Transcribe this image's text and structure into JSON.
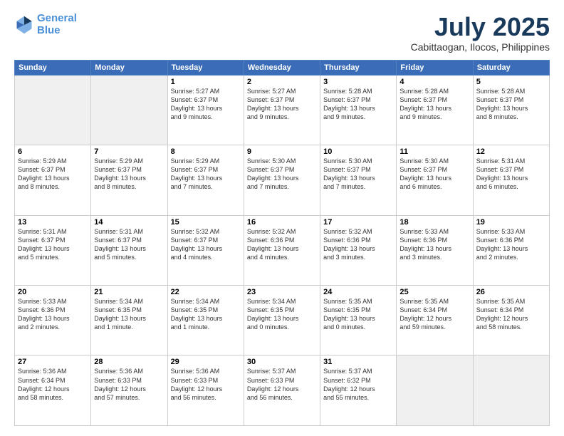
{
  "header": {
    "logo_line1": "General",
    "logo_line2": "Blue",
    "month": "July 2025",
    "location": "Cabittaogan, Ilocos, Philippines"
  },
  "weekdays": [
    "Sunday",
    "Monday",
    "Tuesday",
    "Wednesday",
    "Thursday",
    "Friday",
    "Saturday"
  ],
  "weeks": [
    [
      {
        "day": "",
        "detail": ""
      },
      {
        "day": "",
        "detail": ""
      },
      {
        "day": "1",
        "detail": "Sunrise: 5:27 AM\nSunset: 6:37 PM\nDaylight: 13 hours\nand 9 minutes."
      },
      {
        "day": "2",
        "detail": "Sunrise: 5:27 AM\nSunset: 6:37 PM\nDaylight: 13 hours\nand 9 minutes."
      },
      {
        "day": "3",
        "detail": "Sunrise: 5:28 AM\nSunset: 6:37 PM\nDaylight: 13 hours\nand 9 minutes."
      },
      {
        "day": "4",
        "detail": "Sunrise: 5:28 AM\nSunset: 6:37 PM\nDaylight: 13 hours\nand 9 minutes."
      },
      {
        "day": "5",
        "detail": "Sunrise: 5:28 AM\nSunset: 6:37 PM\nDaylight: 13 hours\nand 8 minutes."
      }
    ],
    [
      {
        "day": "6",
        "detail": "Sunrise: 5:29 AM\nSunset: 6:37 PM\nDaylight: 13 hours\nand 8 minutes."
      },
      {
        "day": "7",
        "detail": "Sunrise: 5:29 AM\nSunset: 6:37 PM\nDaylight: 13 hours\nand 8 minutes."
      },
      {
        "day": "8",
        "detail": "Sunrise: 5:29 AM\nSunset: 6:37 PM\nDaylight: 13 hours\nand 7 minutes."
      },
      {
        "day": "9",
        "detail": "Sunrise: 5:30 AM\nSunset: 6:37 PM\nDaylight: 13 hours\nand 7 minutes."
      },
      {
        "day": "10",
        "detail": "Sunrise: 5:30 AM\nSunset: 6:37 PM\nDaylight: 13 hours\nand 7 minutes."
      },
      {
        "day": "11",
        "detail": "Sunrise: 5:30 AM\nSunset: 6:37 PM\nDaylight: 13 hours\nand 6 minutes."
      },
      {
        "day": "12",
        "detail": "Sunrise: 5:31 AM\nSunset: 6:37 PM\nDaylight: 13 hours\nand 6 minutes."
      }
    ],
    [
      {
        "day": "13",
        "detail": "Sunrise: 5:31 AM\nSunset: 6:37 PM\nDaylight: 13 hours\nand 5 minutes."
      },
      {
        "day": "14",
        "detail": "Sunrise: 5:31 AM\nSunset: 6:37 PM\nDaylight: 13 hours\nand 5 minutes."
      },
      {
        "day": "15",
        "detail": "Sunrise: 5:32 AM\nSunset: 6:37 PM\nDaylight: 13 hours\nand 4 minutes."
      },
      {
        "day": "16",
        "detail": "Sunrise: 5:32 AM\nSunset: 6:36 PM\nDaylight: 13 hours\nand 4 minutes."
      },
      {
        "day": "17",
        "detail": "Sunrise: 5:32 AM\nSunset: 6:36 PM\nDaylight: 13 hours\nand 3 minutes."
      },
      {
        "day": "18",
        "detail": "Sunrise: 5:33 AM\nSunset: 6:36 PM\nDaylight: 13 hours\nand 3 minutes."
      },
      {
        "day": "19",
        "detail": "Sunrise: 5:33 AM\nSunset: 6:36 PM\nDaylight: 13 hours\nand 2 minutes."
      }
    ],
    [
      {
        "day": "20",
        "detail": "Sunrise: 5:33 AM\nSunset: 6:36 PM\nDaylight: 13 hours\nand 2 minutes."
      },
      {
        "day": "21",
        "detail": "Sunrise: 5:34 AM\nSunset: 6:35 PM\nDaylight: 13 hours\nand 1 minute."
      },
      {
        "day": "22",
        "detail": "Sunrise: 5:34 AM\nSunset: 6:35 PM\nDaylight: 13 hours\nand 1 minute."
      },
      {
        "day": "23",
        "detail": "Sunrise: 5:34 AM\nSunset: 6:35 PM\nDaylight: 13 hours\nand 0 minutes."
      },
      {
        "day": "24",
        "detail": "Sunrise: 5:35 AM\nSunset: 6:35 PM\nDaylight: 13 hours\nand 0 minutes."
      },
      {
        "day": "25",
        "detail": "Sunrise: 5:35 AM\nSunset: 6:34 PM\nDaylight: 12 hours\nand 59 minutes."
      },
      {
        "day": "26",
        "detail": "Sunrise: 5:35 AM\nSunset: 6:34 PM\nDaylight: 12 hours\nand 58 minutes."
      }
    ],
    [
      {
        "day": "27",
        "detail": "Sunrise: 5:36 AM\nSunset: 6:34 PM\nDaylight: 12 hours\nand 58 minutes."
      },
      {
        "day": "28",
        "detail": "Sunrise: 5:36 AM\nSunset: 6:33 PM\nDaylight: 12 hours\nand 57 minutes."
      },
      {
        "day": "29",
        "detail": "Sunrise: 5:36 AM\nSunset: 6:33 PM\nDaylight: 12 hours\nand 56 minutes."
      },
      {
        "day": "30",
        "detail": "Sunrise: 5:37 AM\nSunset: 6:33 PM\nDaylight: 12 hours\nand 56 minutes."
      },
      {
        "day": "31",
        "detail": "Sunrise: 5:37 AM\nSunset: 6:32 PM\nDaylight: 12 hours\nand 55 minutes."
      },
      {
        "day": "",
        "detail": ""
      },
      {
        "day": "",
        "detail": ""
      }
    ]
  ]
}
